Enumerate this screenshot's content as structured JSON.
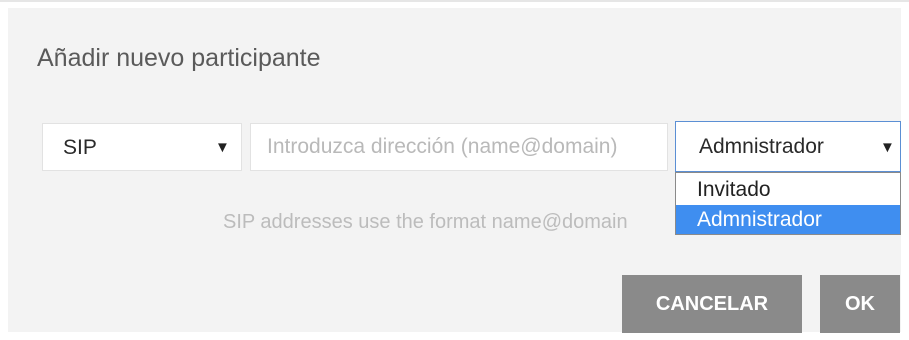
{
  "dialog": {
    "title": "Añadir nuevo participante",
    "protocol_select": {
      "selected": "SIP",
      "arrow": "▼"
    },
    "address_input": {
      "value": "",
      "placeholder": "Introduzca dirección (name@domain)"
    },
    "role_select": {
      "selected": "Admnistrador",
      "arrow": "▼",
      "options": [
        "Invitado",
        "Admnistrador"
      ],
      "highlighted_option": "Admnistrador"
    },
    "hint": "SIP addresses use the format name@domain",
    "buttons": {
      "cancel": "CANCELAR",
      "ok": "OK"
    }
  },
  "colors": {
    "dialog_bg": "#f3f3f3",
    "button_bg": "#8a8a8a",
    "option_highlight": "#3f8ef0",
    "focus_border": "#5b8fd4"
  }
}
